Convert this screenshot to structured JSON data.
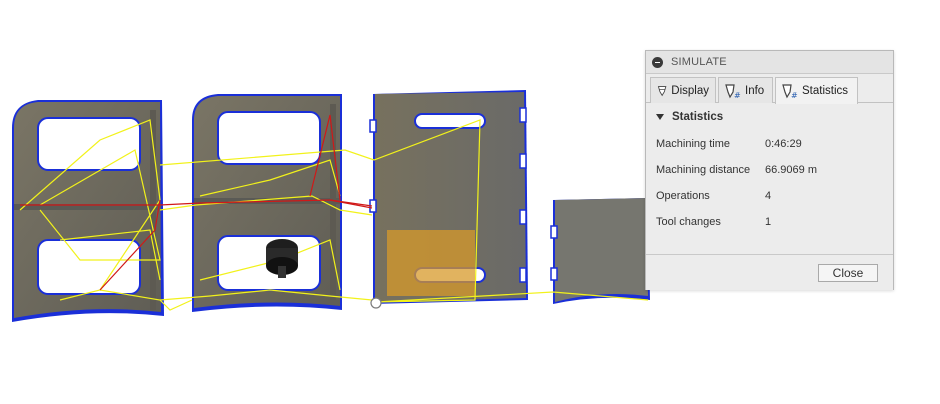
{
  "dialog": {
    "title": "SIMULATE",
    "tabs": [
      {
        "label": "Display",
        "icon": "display-settings-icon",
        "active": false
      },
      {
        "label": "Info",
        "icon": "info-tool-icon",
        "active": false
      },
      {
        "label": "Statistics",
        "icon": "statistics-tool-icon",
        "active": true
      }
    ],
    "section_title": "Statistics",
    "stats": [
      {
        "label": "Machining time",
        "value": "0:46:29"
      },
      {
        "label": "Machining distance",
        "value": "66.9069 m"
      },
      {
        "label": "Operations",
        "value": "4"
      },
      {
        "label": "Tool changes",
        "value": "1"
      }
    ],
    "close_label": "Close"
  },
  "colors": {
    "part_fill": "#6e6a5e",
    "part_edge": "#1a2fd8",
    "toolpath_rapid": "#f2f21a",
    "toolpath_feed": "#d01818",
    "stock_highlight": "#d79a2a"
  }
}
